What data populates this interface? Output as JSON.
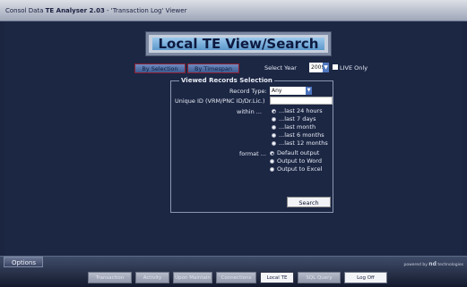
{
  "window": {
    "title_prefix": "Consol Data",
    "app_name": "TE Analyser 2.03",
    "title_suffix": "- 'Transaction Log' Viewer"
  },
  "header": {
    "title": "Local TE View/Search"
  },
  "tabs": [
    {
      "label": "By Selection"
    },
    {
      "label": "By Timespan"
    }
  ],
  "year": {
    "label": "Select Year",
    "value": "2009"
  },
  "live_only": {
    "label": "LIVE Only",
    "checked": false
  },
  "selection": {
    "legend": "Viewed Records Selection",
    "record_type_label": "Record Type:",
    "record_type_value": "Any",
    "unique_id_label": "Unique ID (VRM/PNC ID/Dr.Lic.)",
    "unique_id_value": "",
    "within_label": "within ...",
    "within_options": [
      "...last 24 hours",
      "...last 7 days",
      "...last month",
      "...last 6 months",
      "...last 12 months"
    ],
    "within_selected": 0,
    "format_label": "format ...",
    "format_options": [
      "Default output",
      "Output to Word",
      "Output to Excel"
    ],
    "format_selected": 0,
    "search_label": "Search"
  },
  "footer": {
    "options_label": "Options",
    "powered_by": "powered by",
    "powered_brand": "nd",
    "powered_suffix": "technologies",
    "nav": [
      {
        "label": "Transaction"
      },
      {
        "label": "Activity"
      },
      {
        "label": "Upon Maintain"
      },
      {
        "label": "Connections"
      },
      {
        "label": "Local TE"
      },
      {
        "label": "SQL Query"
      },
      {
        "label": "Log Off"
      }
    ],
    "active_nav": "Local TE"
  }
}
